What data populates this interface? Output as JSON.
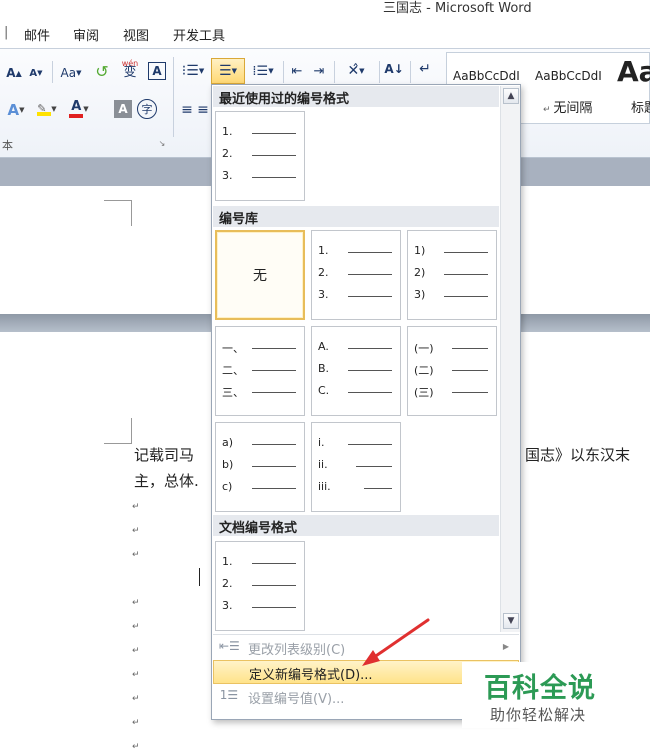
{
  "window": {
    "title": "三国志 - Microsoft Word"
  },
  "tabs": [
    {
      "label": "邮件"
    },
    {
      "label": "审阅"
    },
    {
      "label": "视图"
    },
    {
      "label": "开发工具"
    }
  ],
  "ribbon": {
    "font_size_up": "A",
    "font_size_down": "A",
    "change_case": "Aa",
    "phonetic": "wén",
    "phonetic_char": "变",
    "char_border": "A",
    "text_effect": "A",
    "font_color": "A",
    "char_shading": "A",
    "enclose_char": "字",
    "sort": "A↓",
    "group_label_font": "本",
    "styles": [
      {
        "sample": "AaBbCcDdI",
        "name": ""
      },
      {
        "sample": "AaBbCcDdI",
        "name": "无间隔"
      },
      {
        "sample": "Aa",
        "name": "标题"
      }
    ]
  },
  "dropdown": {
    "recent_header": "最近使用过的编号格式",
    "library_header": "编号库",
    "document_header": "文档编号格式",
    "none_label": "无",
    "recent": [
      {
        "markers": [
          "1.",
          "2.",
          "3."
        ]
      }
    ],
    "library": [
      {
        "markers": [
          "1.",
          "2.",
          "3."
        ]
      },
      {
        "markers": [
          "1)",
          "2)",
          "3)"
        ]
      },
      {
        "markers": [
          "一、",
          "二、",
          "三、"
        ]
      },
      {
        "markers": [
          "A.",
          "B.",
          "C."
        ]
      },
      {
        "markers": [
          "(一)",
          "(二)",
          "(三)"
        ]
      },
      {
        "markers": [
          "a)",
          "b)",
          "c)"
        ]
      },
      {
        "markers": [
          "i.",
          "ii.",
          "iii."
        ]
      }
    ],
    "document": [
      {
        "markers": [
          "1.",
          "2.",
          "3."
        ]
      }
    ],
    "menu": {
      "change_level": "更改列表级别(C)",
      "define_new": "定义新编号格式(D)...",
      "set_value": "设置编号值(V)..."
    }
  },
  "document": {
    "line1_left": "记载司马",
    "line1_right": "国志》以东汉末",
    "line2_left": "主，总体."
  },
  "watermark": {
    "main": "百科全说",
    "sub": "助你轻松解决"
  },
  "colors": {
    "highlight_yellow": "#ffe38a",
    "font_red": "#e02020",
    "watermark_green": "#2c9a55",
    "annotation_red": "#e03030"
  }
}
